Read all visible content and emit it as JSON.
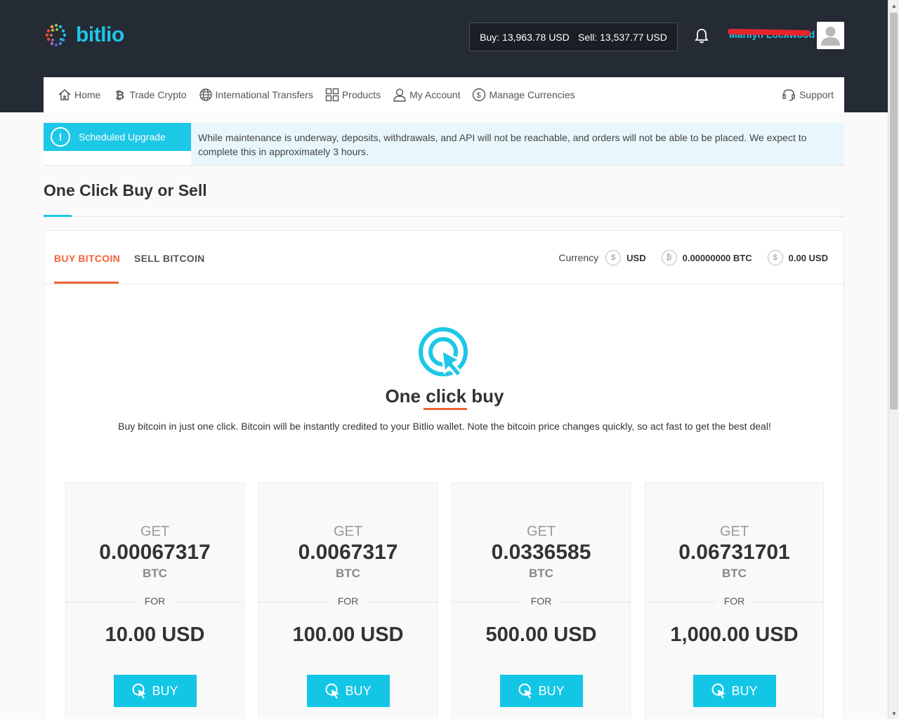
{
  "header": {
    "logo_text": "bitlio",
    "buy_price": "Buy: 13,963.78 USD",
    "sell_price": "Sell: 13,537.77 USD",
    "user_name": "Marilyn Lockwood",
    "brand_color": "#1dc7e6"
  },
  "nav": {
    "items": [
      {
        "label": "Home",
        "icon": "home-icon"
      },
      {
        "label": "Trade Crypto",
        "icon": "bitcoin-icon"
      },
      {
        "label": "International Transfers",
        "icon": "globe-icon"
      },
      {
        "label": "Products",
        "icon": "grid-icon"
      },
      {
        "label": "My Account",
        "icon": "user-icon"
      },
      {
        "label": "Manage Currencies",
        "icon": "dollar-circle-icon"
      }
    ],
    "support": "Support"
  },
  "alert": {
    "tag": "Scheduled Upgrade",
    "message": "While maintenance is underway, deposits, withdrawals, and API will not be reachable, and orders will not be able to be placed. We expect to complete this in approximately 3 hours."
  },
  "page": {
    "title": "One Click Buy or Sell"
  },
  "tabs": {
    "buy": "BUY BITCOIN",
    "sell": "SELL BITCOIN"
  },
  "currency": {
    "label": "Currency",
    "selected": "USD",
    "btc_balance": "0.00000000 BTC",
    "usd_balance": "0.00 USD"
  },
  "hero": {
    "title": "One click buy",
    "description": "Buy bitcoin in just one click. Bitcoin will be instantly credited to your Bitlio wallet. Note the bitcoin price changes quickly, so act fast to get the best deal!"
  },
  "offers": [
    {
      "get": "GET",
      "amount": "0.00067317",
      "unit": "BTC",
      "for": "FOR",
      "price": "10.00 USD",
      "button": "BUY"
    },
    {
      "get": "GET",
      "amount": "0.0067317",
      "unit": "BTC",
      "for": "FOR",
      "price": "100.00 USD",
      "button": "BUY"
    },
    {
      "get": "GET",
      "amount": "0.0336585",
      "unit": "BTC",
      "for": "FOR",
      "price": "500.00 USD",
      "button": "BUY"
    },
    {
      "get": "GET",
      "amount": "0.06731701",
      "unit": "BTC",
      "for": "FOR",
      "price": "1,000.00 USD",
      "button": "BUY"
    }
  ]
}
